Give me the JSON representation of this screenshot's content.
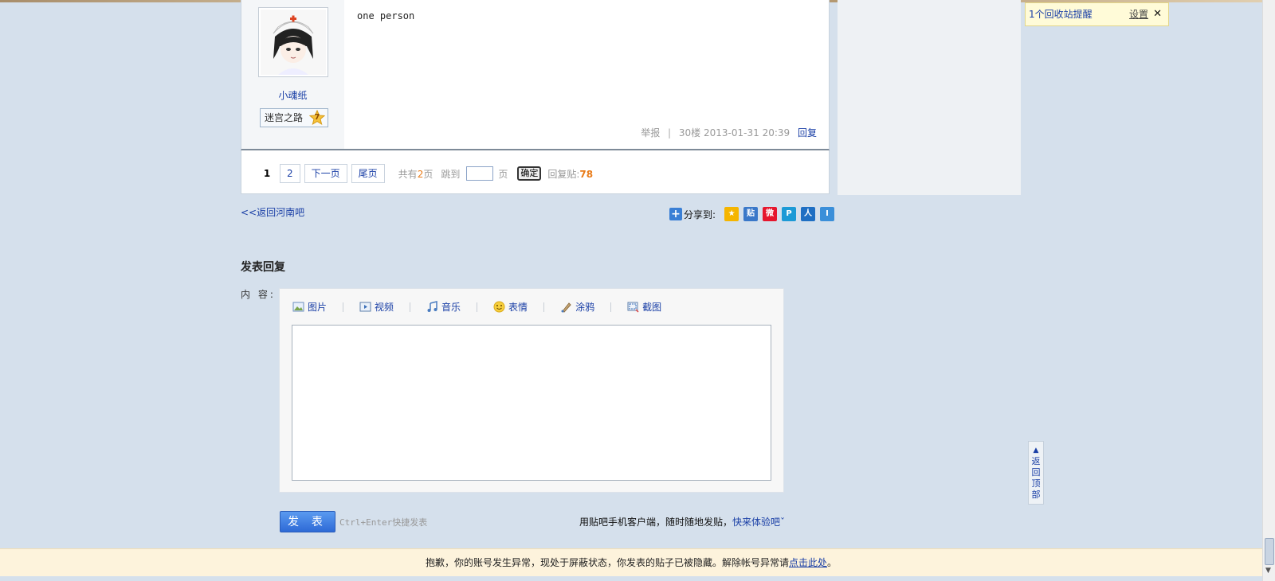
{
  "post": {
    "author": "小魂纸",
    "badge": "迷宫之路",
    "badge_level": "7",
    "content": "one person",
    "report": "举报",
    "floor": "30楼",
    "time": "2013-01-31 20:39",
    "reply": "回复"
  },
  "pager": {
    "current": "1",
    "page2": "2",
    "next": "下一页",
    "last": "尾页",
    "total_prefix": "共有",
    "total_pages": "2",
    "total_suffix": "页",
    "jump_label": "跳到",
    "jump_unit": "页",
    "ok": "确定",
    "replies_label": "回复贴:",
    "replies_count": "78"
  },
  "notice": {
    "text": "1个回收站提醒",
    "settings": "设置",
    "close": "✕"
  },
  "back_link": "<<返回河南吧",
  "share": {
    "label": "分享到:",
    "sites": [
      {
        "name": "qzone",
        "glyph": "★",
        "color": "#f5b500"
      },
      {
        "name": "tieba",
        "glyph": "贴",
        "color": "#3a78c9"
      },
      {
        "name": "weibo",
        "glyph": "微",
        "color": "#e6162d"
      },
      {
        "name": "qq-weibo",
        "glyph": "P",
        "color": "#1c9ad6"
      },
      {
        "name": "renren",
        "glyph": "人",
        "color": "#1f6fc3"
      },
      {
        "name": "kaixin",
        "glyph": "Ⅰ",
        "color": "#3b8fd9"
      }
    ]
  },
  "reply_form": {
    "title": "发表回复",
    "content_label": "内 容:",
    "tools": [
      "图片",
      "视频",
      "音乐",
      "表情",
      "涂鸦",
      "截图"
    ],
    "submit": "发 表",
    "shortcut": "Ctrl+Enter快捷发表",
    "mobile_tip": "用贴吧手机客户端，随时随地发贴，",
    "mobile_link": "快来体验吧ˇ"
  },
  "back_to_top": [
    "返",
    "回",
    "顶",
    "部"
  ],
  "warning": {
    "text": "抱歉，你的账号发生异常，现处于屏蔽状态，你发表的贴子已被隐藏。解除帐号异常请",
    "link": "点击此处",
    "end": "。"
  }
}
